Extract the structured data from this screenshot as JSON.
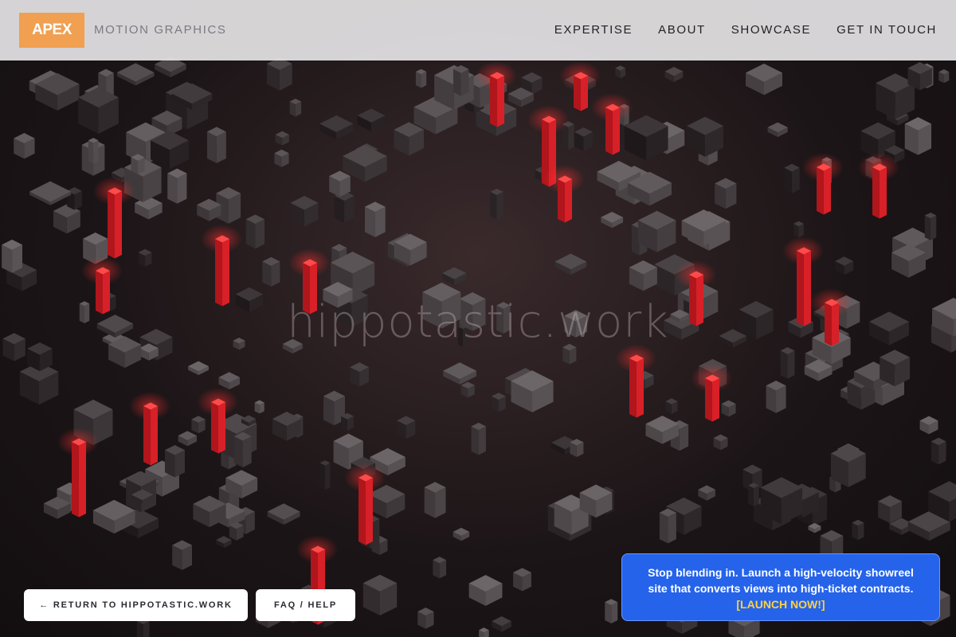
{
  "header": {
    "logo": "APEX",
    "tagline": "MOTION GRAPHICS",
    "nav": [
      "EXPERTISE",
      "ABOUT",
      "SHOWCASE",
      "GET IN TOUCH"
    ]
  },
  "hero": {
    "watermark": "hippotastic.work"
  },
  "buttons": {
    "return_label": "← RETURN TO HIPPOTASTIC.WORK",
    "faq_label": "FAQ / HELP"
  },
  "promo": {
    "text": "Stop blending in. Launch a high-velocity showreel site that converts views into high-ticket contracts.",
    "cta": "[LAUNCH NOW!]"
  },
  "colors": {
    "logo_bg": "#f0a050",
    "promo_bg": "#2563eb",
    "cta": "#ffd23f",
    "accent_red": "#e0262c"
  }
}
